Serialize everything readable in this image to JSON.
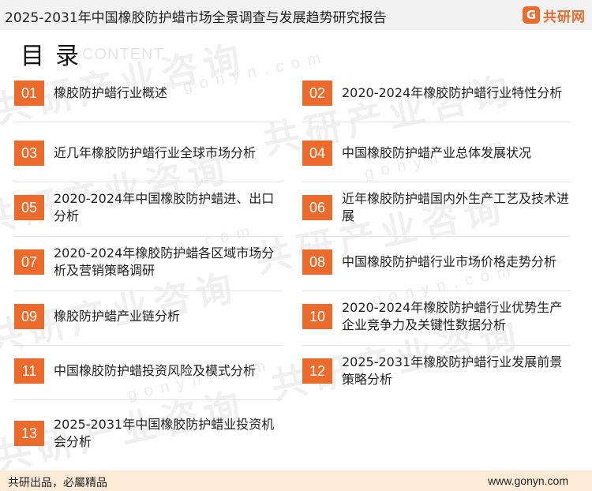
{
  "header": {
    "title": "2025-2031年中国橡胶防护蜡市场全景调查与发展趋势研究报告",
    "logo_mark": "G",
    "logo_text": "共研网"
  },
  "toc": {
    "title": "目录",
    "subtitle": "CONTENT",
    "items": [
      {
        "num": "01",
        "label": "橡胶防护蜡行业概述"
      },
      {
        "num": "02",
        "label": "2020-2024年橡胶防护蜡行业特性分析"
      },
      {
        "num": "03",
        "label": "近几年橡胶防护蜡行业全球市场分析"
      },
      {
        "num": "04",
        "label": "中国橡胶防护蜡产业总体发展状况"
      },
      {
        "num": "05",
        "label": "2020-2024年中国橡胶防护蜡进、出口分析"
      },
      {
        "num": "06",
        "label": "近年橡胶防护蜡国内外生产工艺及技术进展"
      },
      {
        "num": "07",
        "label": "2020-2024年橡胶防护蜡各区域市场分析及营销策略调研"
      },
      {
        "num": "08",
        "label": "中国橡胶防护蜡行业市场价格走势分析"
      },
      {
        "num": "09",
        "label": "橡胶防护蜡产业链分析"
      },
      {
        "num": "10",
        "label": "2020-2024年橡胶防护蜡行业优势生产企业竞争力及关键性数据分析"
      },
      {
        "num": "11",
        "label": "中国橡胶防护蜡投资风险及模式分析"
      },
      {
        "num": "12",
        "label": "2025-2031年橡胶防护蜡行业发展前景策略分析"
      },
      {
        "num": "13",
        "label": "2025-2031年中国橡胶防护蜡业投资机会分析"
      }
    ]
  },
  "watermark": {
    "text": "共研产业咨询",
    "url": "gonyn.com"
  },
  "footer": {
    "left": "共研出品，必屬精品",
    "right": "www.gonyn.com"
  },
  "colors": {
    "accent": "#ec6a2c",
    "footer_bg": "#fdebd7",
    "header_bg": "#f2f2f2"
  }
}
